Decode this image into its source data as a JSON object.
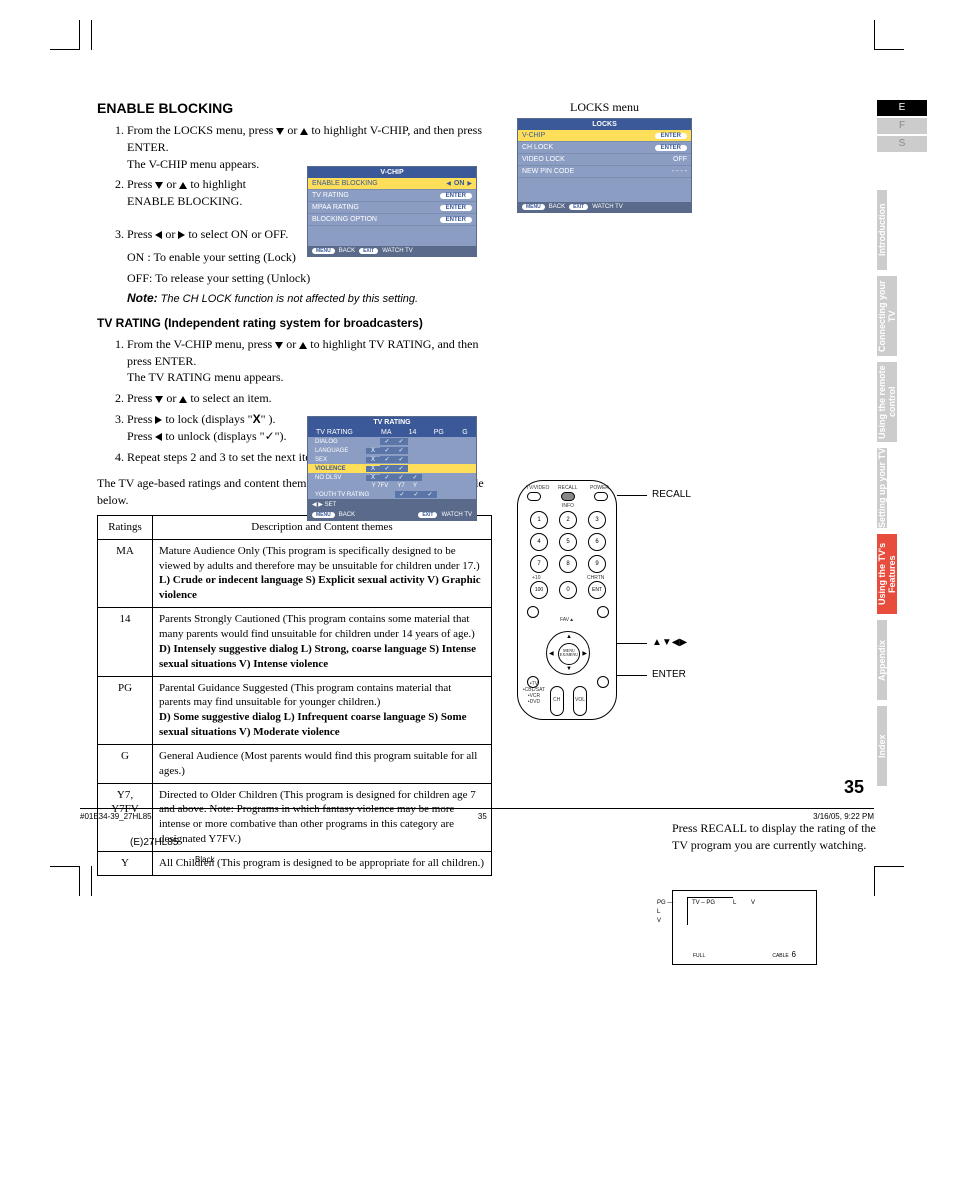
{
  "headings": {
    "enable_blocking": "ENABLE BLOCKING",
    "tv_rating": "TV RATING (Independent rating system for broadcasters)"
  },
  "enable_blocking": {
    "step1": "From the LOCKS menu, press ▼ or ▲ to highlight V-CHIP, and then press ENTER.",
    "step1b": "The V-CHIP menu appears.",
    "step2a": "Press ▼ or ▲ to highlight",
    "step2b": "ENABLE BLOCKING.",
    "step3": "Press ◀ or ▶ to select ON or OFF.",
    "on": "ON : To enable your setting (Lock)",
    "off": "OFF: To release your setting (Unlock)",
    "note_label": "Note:",
    "note": "The CH LOCK function is not affected by this setting."
  },
  "tv_rating": {
    "step1": "From the V-CHIP menu, press ▼ or ▲ to highlight TV RATING, and then press ENTER.",
    "step1b": "The TV RATING menu appears.",
    "step2": "Press ▼ or ▲ to select an item.",
    "step3a": "Press ▶ to lock (displays \"X\" ).",
    "step3b": "Press ◀ to unlock (displays \"✓\").",
    "step4": "Repeat steps 2 and 3 to set the next item.",
    "para": "The TV age-based ratings and content themes you can lock are listed in the table below."
  },
  "vchip_menu": {
    "title": "V-CHIP",
    "rows": {
      "enable": "ENABLE BLOCKING",
      "enable_val": "ON",
      "tvr": "TV RATING",
      "mpaa": "MPAA RATING",
      "block": "BLOCKING OPTION"
    },
    "enter": "ENTER",
    "foot": {
      "menu": "MENU",
      "back": "BACK",
      "exit": "EXIT",
      "watch": "WATCH TV"
    }
  },
  "tvrating_menu": {
    "title": "TV RATING",
    "cols": [
      "MA",
      "14",
      "PG",
      "G"
    ],
    "rows": [
      "TV RATING",
      "DIALOG",
      "LANGUAGE",
      "SEX",
      "VIOLENCE",
      "NO DLSV",
      "",
      "YOUTH TV RATING"
    ],
    "y_cols": [
      "Y 7FV",
      "Y7",
      "Y"
    ],
    "set": "SET",
    "foot": {
      "menu": "MENU",
      "back": "BACK",
      "exit": "EXIT",
      "watch": "WATCH TV"
    }
  },
  "locks_menu": {
    "title_text": "LOCKS menu",
    "title": "LOCKS",
    "rows": {
      "vchip": "V-CHIP",
      "chlock": "CH LOCK",
      "vlock": "VIDEO LOCK",
      "pin": "NEW PIN CODE"
    },
    "vals": {
      "vchip": "ENTER",
      "chlock": "ENTER",
      "vlock": "OFF",
      "pin": "- - - -"
    },
    "foot": {
      "menu": "MENU",
      "back": "BACK",
      "exit": "EXIT",
      "watch": "WATCH TV"
    }
  },
  "letters": {
    "E": "E",
    "F": "F",
    "S": "S"
  },
  "tabs": [
    "Introduction",
    "Connecting your TV",
    "Using the remote control",
    "Setting up your TV",
    "Using the TV's Features",
    "Appendix",
    "Index"
  ],
  "table": {
    "hd1": "Ratings",
    "hd2": "Description and Content themes",
    "rows": [
      {
        "r": "MA",
        "d": "Mature Audience Only (This program is specifically designed to be viewed by adults and therefore may be unsuitable for children under 17.)",
        "b": "L) Crude or indecent language  S) Explicit sexual activity  V) Graphic violence"
      },
      {
        "r": "14",
        "d": "Parents Strongly Cautioned (This program contains some material that many parents would find unsuitable for children under 14 years of age.)",
        "b": "D) Intensely suggestive dialog  L) Strong, coarse language  S) Intense sexual situations  V) Intense violence"
      },
      {
        "r": "PG",
        "d": "Parental Guidance Suggested (This program contains material that parents may find unsuitable for younger children.)",
        "b": "D) Some suggestive dialog  L) Infrequent coarse language  S) Some sexual situations  V) Moderate violence"
      },
      {
        "r": "G",
        "d": "General Audience (Most parents would find this program suitable for all ages.)",
        "b": ""
      },
      {
        "r": "Y7, Y7FV",
        "d": "Directed to Older Children (This program is designed for children age 7 and above. Note: Programs in which fantasy violence may be more intense or more combative than other programs in this category are designated Y7FV.)",
        "b": ""
      },
      {
        "r": "Y",
        "d": "All Children (This program is designed to be appropriate for all children.)",
        "b": ""
      }
    ]
  },
  "callouts": {
    "recall": "RECALL",
    "arrows": "▲▼◀▶",
    "enter": "ENTER"
  },
  "recall_text": "Press RECALL to display the rating of the TV program you are currently watching.",
  "recall_box": {
    "pg": "PG",
    "l": "L",
    "v": "V",
    "tvpg": "TV – PG",
    "ll": "L",
    "vv": "V",
    "full": "FULL",
    "cable": "CABLE",
    "ch": "6"
  },
  "page_num": "35",
  "footer": {
    "left": "#01E34-39_27HL85",
    "mid": "35",
    "right": "3/16/05, 9:22 PM"
  },
  "model": "(E)27HL85",
  "black": "Black",
  "remote": {
    "tvvideo": "TV/VIDEO",
    "recall": "RECALL",
    "power": "POWER",
    "info": "INFO",
    "fav": "FAV▲",
    "menu": "MENU",
    "ex": "EX/MENU",
    "ch": "CH",
    "vol": "VOL",
    "tvmode": "•TV\n•CBL/SAT\n•VCR\n•DVD",
    "p10": "+10",
    "chrtn": "CHRTN",
    "ent": "ENT"
  }
}
